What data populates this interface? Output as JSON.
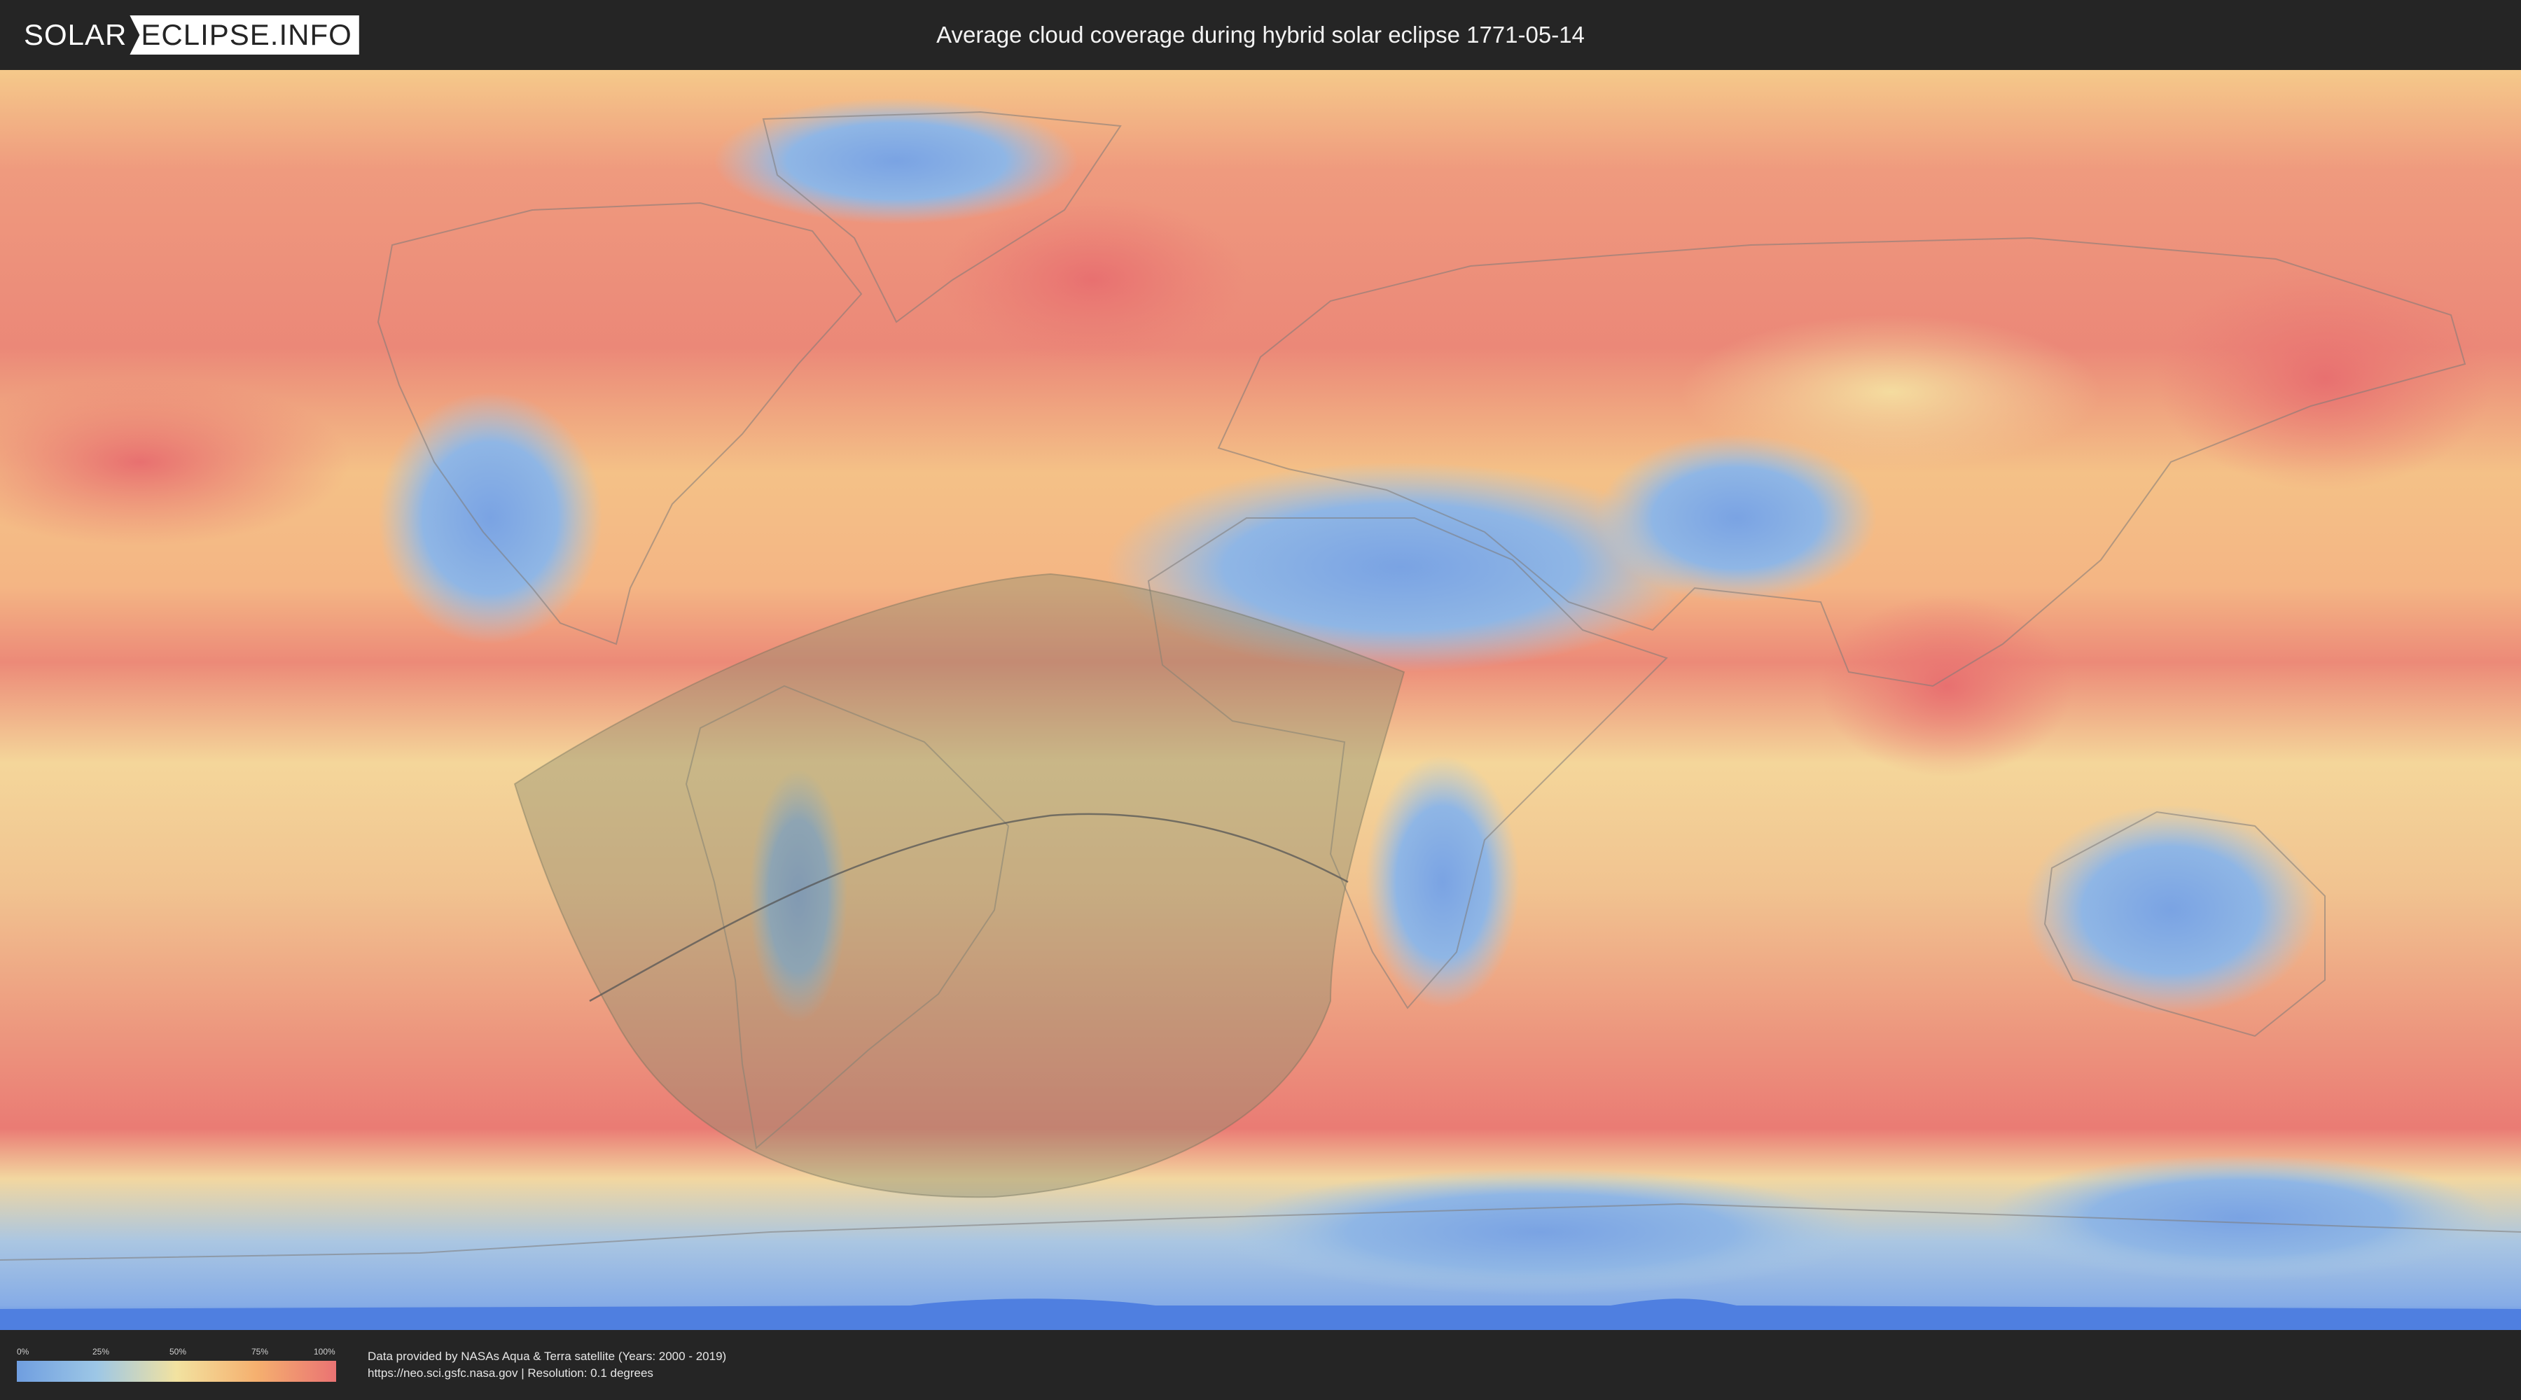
{
  "header": {
    "logo_part1": "SOLAR",
    "logo_part2": "ECLIPSE.INFO",
    "title": "Average cloud coverage during hybrid solar eclipse 1771-05-14"
  },
  "map": {
    "projection": "equirectangular",
    "palette": {
      "clear": "#6f9ee0",
      "low": "#9dc7e6",
      "mid": "#f2e2a0",
      "high": "#f5b06f",
      "overcast": "#ea7373",
      "polar_ice": "#4f7fe0"
    },
    "eclipse_overlay_color": "#8c8c6e"
  },
  "legend": {
    "labels": [
      "0%",
      "25%",
      "50%",
      "75%",
      "100%"
    ]
  },
  "attribution": {
    "line1": "Data provided by NASAs Aqua & Terra satellite (Years: 2000 - 2019)",
    "line2": "https://neo.sci.gsfc.nasa.gov | Resolution: 0.1 degrees"
  }
}
